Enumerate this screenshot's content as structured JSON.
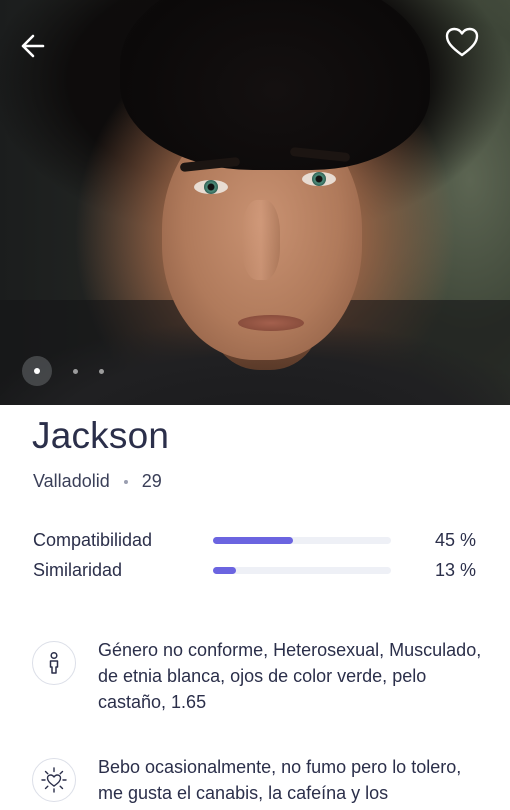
{
  "profile": {
    "name": "Jackson",
    "city": "Valladolid",
    "age": "29"
  },
  "photo_gallery": {
    "total_photos": 3,
    "active_index": 0
  },
  "stats": [
    {
      "label": "Compatibilidad",
      "value_text": "45 %",
      "percent": 45
    },
    {
      "label": "Similaridad",
      "value_text": "13 %",
      "percent": 13
    }
  ],
  "details": [
    {
      "icon": "person-icon",
      "text": "Género no conforme, Heterosexual, Musculado, de etnia blanca, ojos de color verde, pelo castaño, 1.65"
    },
    {
      "icon": "heart-sparkle-icon",
      "text": "Bebo ocasionalmente, no fumo pero lo tolero, me gusta el canabis, la cafeína y los"
    }
  ],
  "colors": {
    "accent": "#6b64e0",
    "text": "#2b2f4a",
    "track": "#eef0f6"
  },
  "icons": {
    "back": "back-arrow-icon",
    "favorite": "heart-outline-icon"
  }
}
